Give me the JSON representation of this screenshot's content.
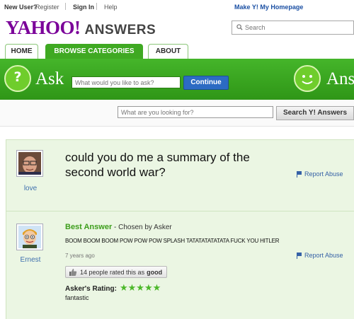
{
  "topbar": {
    "new_user": "New User?",
    "register": "Register",
    "sign_in": "Sign In",
    "help": "Help",
    "make_homepage": "Make Y! My Homepage"
  },
  "header": {
    "logo_yahoo": "YAHOO!",
    "logo_answers": "ANSWERS",
    "search_placeholder": "Search"
  },
  "tabs": [
    {
      "label": "HOME",
      "active": false
    },
    {
      "label": "BROWSE CATEGORIES",
      "active": true
    },
    {
      "label": "ABOUT",
      "active": false
    }
  ],
  "ask_band": {
    "ask_label": "Ask",
    "ask_placeholder": "What would you like to ask?",
    "continue_label": "Continue",
    "answer_label_partial": "Ans"
  },
  "look_search": {
    "placeholder": "What are you looking for?",
    "button_label": "Search Y! Answers"
  },
  "question": {
    "asker_name": "love",
    "text": "could you do me a summary of the second world war?",
    "report_label": "Report Abuse"
  },
  "answer": {
    "answerer_name": "Ernest",
    "best_answer_label": "Best Answer",
    "chosen_by": "- Chosen by Asker",
    "text": "BOOM BOOM BOOM POW POW POW SPLASH TATATATATATATA  FUCK YOU HITLER",
    "time_ago": "7 years ago",
    "report_label": "Report Abuse",
    "rated_prefix": "14 people rated this as",
    "rated_word": "good",
    "asker_rating_label": "Asker's Rating:",
    "stars": "★★★★★",
    "star_count": 5,
    "asker_comment": "fantastic"
  },
  "colors": {
    "brand_purple": "#7b0099",
    "green": "#3fa922",
    "link_blue": "#3561a6",
    "panel_bg": "#ebf6e3",
    "star_green": "#4cb82a"
  }
}
